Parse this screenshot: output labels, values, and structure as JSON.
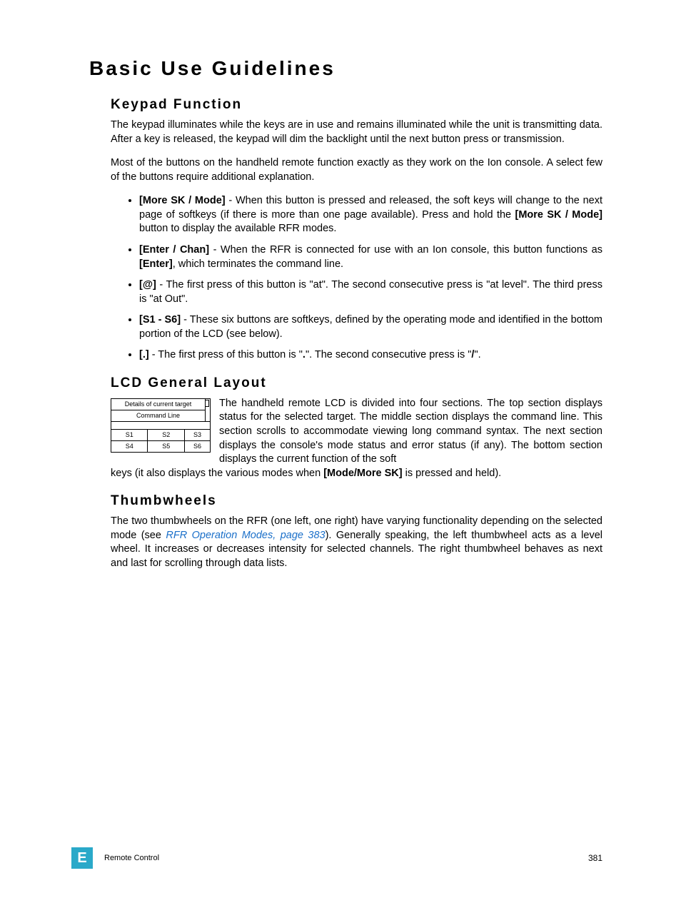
{
  "title": "Basic Use Guidelines",
  "sections": {
    "keypad": {
      "heading": "Keypad Function",
      "p1": "The keypad illuminates while the keys are in use and remains illuminated while the unit is transmitting data. After a key is released, the keypad will dim the backlight until the next button press or transmission.",
      "p2": "Most of the buttons on the handheld remote function exactly as they work on the Ion console. A select few of the buttons require additional explanation.",
      "items": [
        {
          "label": "[More SK / Mode]",
          "mid": " - When this button is pressed and released, the soft keys will change to the next page of softkeys (if there is more than one page available). Press and hold the ",
          "label2": "[More SK / Mode]",
          "tail": " button to display the available RFR modes."
        },
        {
          "label": "[Enter / Chan]",
          "mid": " - When the RFR is connected for use with an Ion console, this button functions as ",
          "label2": "[Enter]",
          "tail": ", which terminates the command line."
        },
        {
          "label": "[@]",
          "mid": " - The first press of this button is \"at\". The second consecutive press is \"at level\". The third press is \"at Out\".",
          "label2": "",
          "tail": ""
        },
        {
          "label": "[S1 - S6]",
          "mid": " - These six buttons are softkeys, defined by the operating mode and identified in the bottom portion of the LCD (see below).",
          "label2": "",
          "tail": ""
        },
        {
          "label": "[.]",
          "mid": " - The first press of this button is \"",
          "bolddot": ".",
          "mid2": "\". The second consecutive press is \"",
          "boldslash": "/",
          "tail": "\"."
        }
      ]
    },
    "lcd": {
      "heading": "LCD General Layout",
      "diagram": {
        "r1": "Details of current target",
        "r2": "Command Line",
        "s1": "S1",
        "s2": "S2",
        "s3": "S3",
        "s4": "S4",
        "s5": "S5",
        "s6": "S6"
      },
      "para": "The handheld remote LCD is divided into four sections. The top section displays status for the selected target. The middle section displays the command line. This section scrolls to accommodate viewing long command syntax. The next section displays the console's mode status and error status (if any). The bottom section displays the current function of the soft",
      "follow_pre": "keys (it also displays the various modes when ",
      "follow_bold": "[Mode/More SK]",
      "follow_post": " is pressed and held)."
    },
    "thumb": {
      "heading": "Thumbwheels",
      "pre": "The two thumbwheels on the RFR (one left, one right) have varying functionality depending on the selected mode (see ",
      "link": "RFR Operation Modes, page 383",
      "post": "). Generally speaking, the left thumbwheel acts as a level wheel. It increases or decreases intensity for selected channels. The right thumbwheel behaves as next and last for scrolling through data lists."
    }
  },
  "footer": {
    "badge": "E",
    "title": "Remote Control",
    "page": "381"
  }
}
